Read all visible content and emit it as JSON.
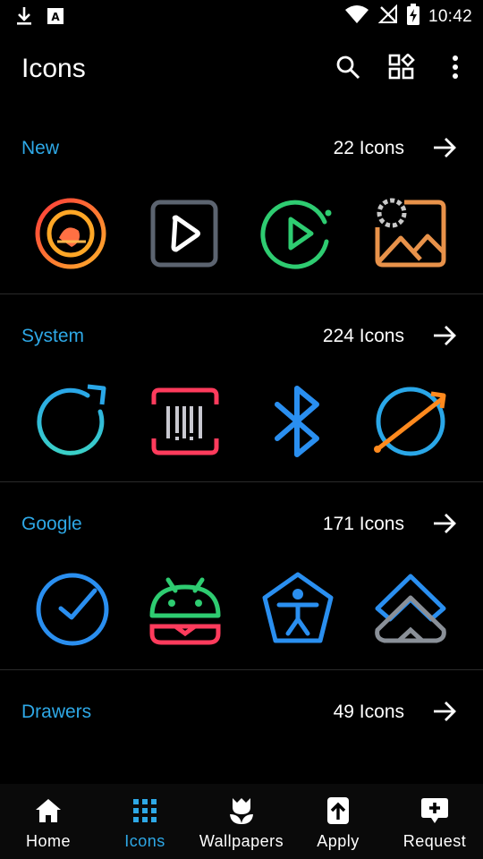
{
  "status_bar": {
    "time": "10:42",
    "icons": [
      "download-icon",
      "keyboard-a-icon",
      "wifi-icon",
      "no-signal-icon",
      "battery-charging-icon"
    ]
  },
  "app_bar": {
    "title": "Icons",
    "actions": [
      "search-icon",
      "grid-apps-icon",
      "more-vert-icon"
    ]
  },
  "sections": [
    {
      "name": "New",
      "count": "22 Icons",
      "icons": [
        "music-disc-icon",
        "play-square-icon",
        "play-circle-icon",
        "gallery-icon"
      ]
    },
    {
      "name": "System",
      "count": "224 Icons",
      "icons": [
        "refresh-icon",
        "barcode-scanner-icon",
        "bluetooth-icon",
        "orbit-launch-icon"
      ]
    },
    {
      "name": "Google",
      "count": "171 Icons",
      "icons": [
        "clock-icon",
        "android-burger-icon",
        "accessibility-icon",
        "home-arrow-icon"
      ]
    },
    {
      "name": "Drawers",
      "count": "49 Icons",
      "icons": [
        "drawer-purple-icon",
        "drawer-violet-icon",
        "drawer-blue-icon",
        "drawer-green-icon"
      ]
    }
  ],
  "bottom_nav": [
    {
      "label": "Home",
      "icon": "home-icon",
      "active": false
    },
    {
      "label": "Icons",
      "icon": "icons-grid-icon",
      "active": true
    },
    {
      "label": "Wallpapers",
      "icon": "tulip-icon",
      "active": false
    },
    {
      "label": "Apply",
      "icon": "apply-upload-icon",
      "active": false
    },
    {
      "label": "Request",
      "icon": "request-plus-icon",
      "active": false
    }
  ],
  "colors": {
    "accent": "#2ea8e6",
    "background": "#000000",
    "divider": "#2a2a2a"
  }
}
